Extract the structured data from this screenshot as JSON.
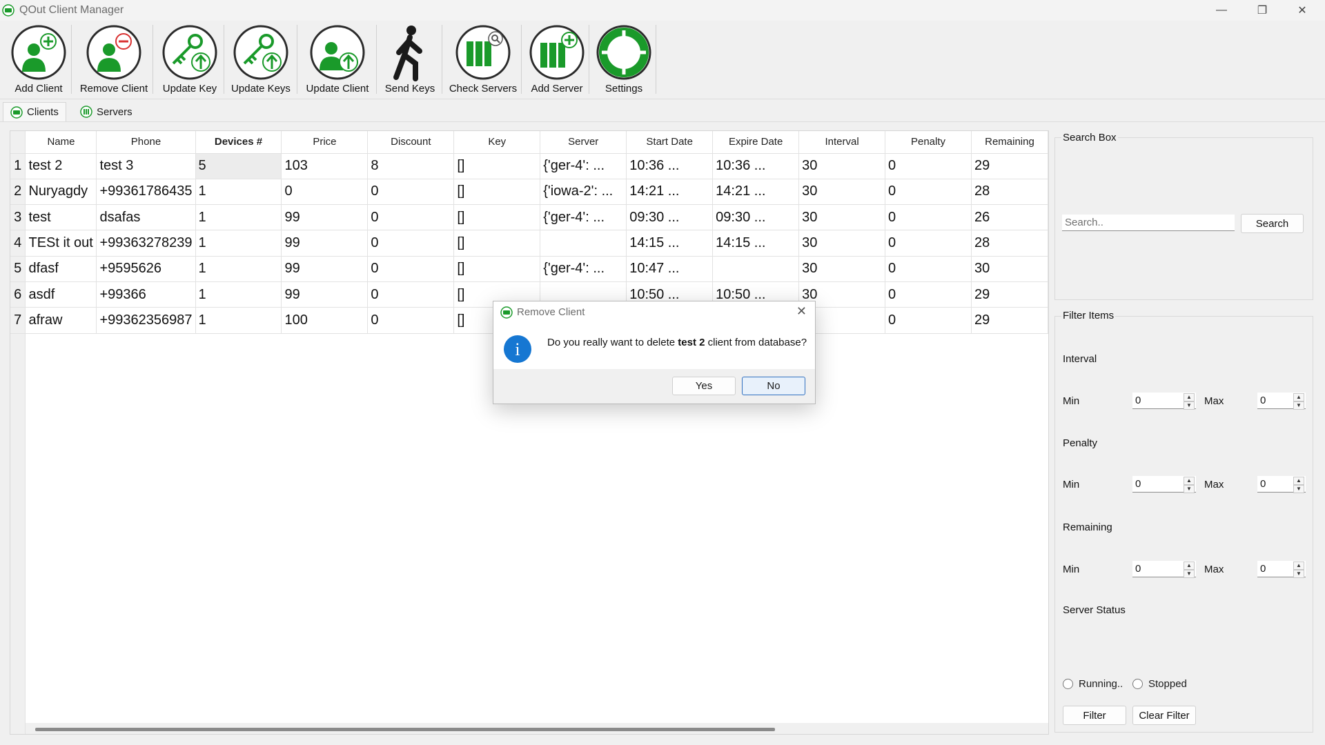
{
  "window": {
    "title": "QOut Client Manager",
    "minimize": "—",
    "restore": "❐",
    "close": "✕",
    "accent": "#1a9a2a"
  },
  "toolbar": {
    "items": [
      {
        "label": "Add Client",
        "icon": "add-client-icon"
      },
      {
        "label": "Remove Client",
        "icon": "remove-client-icon"
      },
      {
        "label": "Update Key",
        "icon": "update-key-icon"
      },
      {
        "label": "Update Keys",
        "icon": "update-keys-icon"
      },
      {
        "label": "Update Client",
        "icon": "update-client-icon"
      },
      {
        "label": "Send Keys",
        "icon": "walking-person-icon"
      },
      {
        "label": "Check Servers",
        "icon": "check-servers-icon"
      },
      {
        "label": "Add Server",
        "icon": "add-server-icon"
      },
      {
        "label": "Settings",
        "icon": "lifebuoy-settings-icon"
      }
    ]
  },
  "tabs": [
    {
      "label": "Clients",
      "active": true
    },
    {
      "label": "Servers",
      "active": false
    }
  ],
  "table": {
    "columns": [
      "Name",
      "Phone",
      "Devices #",
      "Price",
      "Discount",
      "Key",
      "Server",
      "Start Date",
      "Expire Date",
      "Interval",
      "Penalty",
      "Remaining"
    ],
    "rows": [
      {
        "num": "1",
        "cells": [
          "test 2",
          "test 3",
          "5",
          "103",
          "8",
          "[]",
          "{'ger-4': ...",
          "10:36 ...",
          "10:36 ...",
          "30",
          "0",
          "29"
        ]
      },
      {
        "num": "2",
        "cells": [
          "Nuryagdy",
          "+99361786435",
          "1",
          "0",
          "0",
          "[]",
          "{'iowa-2': ...",
          "14:21 ...",
          "14:21 ...",
          "30",
          "0",
          "28"
        ]
      },
      {
        "num": "3",
        "cells": [
          "test",
          "dsafas",
          "1",
          "99",
          "0",
          "[]",
          "{'ger-4': ...",
          "09:30 ...",
          "09:30 ...",
          "30",
          "0",
          "26"
        ]
      },
      {
        "num": "4",
        "cells": [
          "TESt it out",
          "+99363278239",
          "1",
          "99",
          "0",
          "[]",
          "",
          "14:15 ...",
          "14:15 ...",
          "30",
          "0",
          "28"
        ]
      },
      {
        "num": "5",
        "cells": [
          "dfasf",
          "+9595626",
          "1",
          "99",
          "0",
          "[]",
          "{'ger-4': ...",
          "10:47 ...",
          "",
          "30",
          "0",
          "30"
        ]
      },
      {
        "num": "6",
        "cells": [
          "asdf",
          "+99366",
          "1",
          "99",
          "0",
          "[]",
          "",
          "10:50 ...",
          "10:50 ...",
          "30",
          "0",
          "29"
        ]
      },
      {
        "num": "7",
        "cells": [
          "afraw",
          "+99362356987",
          "1",
          "100",
          "0",
          "[]",
          "",
          "",
          "",
          "",
          "0",
          "29"
        ]
      }
    ]
  },
  "search_box": {
    "title": "Search Box",
    "placeholder": "Search..",
    "button": "Search"
  },
  "filter": {
    "title": "Filter Items",
    "interval": {
      "label": "Interval",
      "min_label": "Min",
      "min": "0",
      "max_label": "Max",
      "max": "0"
    },
    "penalty": {
      "label": "Penalty",
      "min_label": "Min",
      "min": "0",
      "max_label": "Max",
      "max": "0"
    },
    "remaining": {
      "label": "Remaining",
      "min_label": "Min",
      "min": "0",
      "max_label": "Max",
      "max": "0"
    },
    "server_status": {
      "label": "Server Status",
      "running": "Running..",
      "stopped": "Stopped"
    },
    "filter_button": "Filter",
    "clear_button": "Clear Filter"
  },
  "dialog": {
    "title": "Remove Client",
    "message_pre": "Do you really want to delete ",
    "message_bold": "test 2",
    "message_post": " client from database?",
    "yes": "Yes",
    "no": "No",
    "close": "✕",
    "info_glyph": "i",
    "info_color": "#1677d2"
  }
}
